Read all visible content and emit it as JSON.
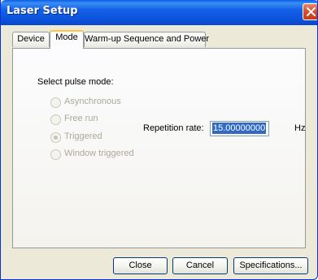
{
  "window": {
    "title": "Laser Setup"
  },
  "tabs": [
    {
      "label": "Device",
      "active": false
    },
    {
      "label": "Mode",
      "active": true
    },
    {
      "label": "Warm-up Sequence and Power",
      "active": false
    }
  ],
  "mode_panel": {
    "select_label": "Select pulse mode:",
    "pulse_modes": [
      {
        "label": "Asynchronous",
        "selected": false,
        "enabled": false
      },
      {
        "label": "Free run",
        "selected": false,
        "enabled": false
      },
      {
        "label": "Triggered",
        "selected": true,
        "enabled": false
      },
      {
        "label": "Window triggered",
        "selected": false,
        "enabled": false
      }
    ],
    "repetition_rate": {
      "label": "Repetition rate:",
      "value": "15.00000000",
      "unit": "Hz"
    }
  },
  "buttons": {
    "close": "Close",
    "cancel": "Cancel",
    "specifications": "Specifications..."
  },
  "colors": {
    "title_bar": "#0a5ee4",
    "close_button": "#d7512f",
    "active_tab_accent": "#ffc83c",
    "dialog_background": "#ece9d8",
    "disabled_text": "#aca899",
    "selection_highlight": "#316ac5"
  }
}
